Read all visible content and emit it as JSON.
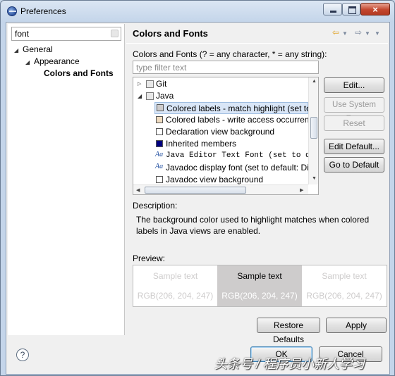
{
  "window": {
    "title": "Preferences",
    "close_glyph": "×"
  },
  "sidebar": {
    "filter_value": "font",
    "tree": [
      {
        "label": "General",
        "expanded": true
      },
      {
        "label": "Appearance",
        "expanded": true
      },
      {
        "label": "Colors and Fonts",
        "selected": true
      }
    ]
  },
  "page": {
    "title": "Colors and Fonts",
    "filter_label": "Colors and Fonts (? = any character, * = any string):",
    "filter_placeholder": "type filter text",
    "tree": {
      "groups": [
        {
          "label": "Git",
          "expanded": false
        },
        {
          "label": "Java",
          "expanded": true
        }
      ],
      "items": [
        {
          "label": "Colored labels - match highlight (set to default: ...)",
          "kind": "color",
          "swatch": "#cecccc",
          "selected": true
        },
        {
          "label": "Colored labels - write access occurrences",
          "kind": "color",
          "swatch": "#f0dcc0"
        },
        {
          "label": "Declaration view background",
          "kind": "color",
          "swatch": "#ffffff"
        },
        {
          "label": "Inherited members",
          "kind": "color",
          "swatch": "#000080"
        },
        {
          "label": "Java Editor Text Font (set to default: ...)",
          "kind": "font",
          "mono": true
        },
        {
          "label": "Javadoc display font (set to default: Dialog)",
          "kind": "font"
        },
        {
          "label": "Javadoc view background",
          "kind": "color",
          "swatch": "#ffffff"
        }
      ],
      "font_icon_text": "Aa"
    },
    "buttons": {
      "edit": "Edit...",
      "use_system_font": "Use System Font",
      "reset": "Reset",
      "edit_default": "Edit Default...",
      "go_to_default": "Go to Default"
    },
    "description_label": "Description:",
    "description_text": "The background color used to highlight matches when colored labels in Java views are enabled.",
    "preview_label": "Preview:",
    "preview": [
      {
        "sample": "Sample text",
        "rgb": "RGB(206, 204, 247)",
        "bg": "#ffffff",
        "fg": "#cecccc"
      },
      {
        "sample": "Sample text",
        "rgb": "RGB(206, 204, 247)",
        "bg": "#cecccc",
        "fg": "#000000"
      },
      {
        "sample": "Sample text",
        "rgb": "RGB(206, 204, 247)",
        "bg": "#ffffff",
        "fg": "#cecccc"
      }
    ],
    "restore_defaults": "Restore Defaults",
    "apply": "Apply"
  },
  "footer": {
    "help": "?",
    "ok": "OK",
    "cancel": "Cancel"
  },
  "watermark": "头条号 / 程序员小新人学习"
}
